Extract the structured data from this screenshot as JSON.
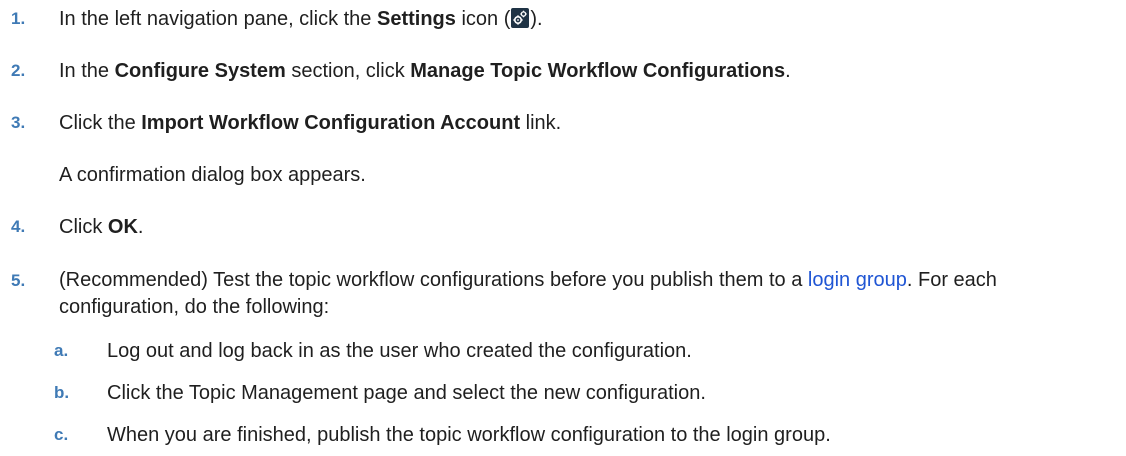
{
  "steps": [
    {
      "number": "1.",
      "pre": "In the left navigation pane, click the ",
      "bold": "Settings",
      "mid": " icon (",
      "icon": "settings-gear-icon",
      "post": ")."
    },
    {
      "number": "2.",
      "pre": "In the ",
      "bold1": "Configure System",
      "mid": " section, click ",
      "bold2": "Manage Topic Workflow Configurations",
      "post": "."
    },
    {
      "number": "3.",
      "pre": "Click the ",
      "bold": "Import Workflow Configuration Account",
      "post": " link.",
      "note": "A confirmation dialog box appears."
    },
    {
      "number": "4.",
      "pre": "Click ",
      "bold": "OK",
      "post": "."
    },
    {
      "number": "5.",
      "pre": "(Recommended) Test the topic workflow configurations before you publish them to a ",
      "link": "login group",
      "post": ". For each configuration, do the following:",
      "substeps": [
        {
          "letter": "a.",
          "text": "Log out and log back in as the user who created the configuration."
        },
        {
          "letter": "b.",
          "text": "Click the Topic Management page and select the new configuration."
        },
        {
          "letter": "c.",
          "text": "When you are finished, publish the topic workflow configuration to the login group."
        }
      ]
    }
  ],
  "colors": {
    "number": "#3f7ab5",
    "link": "#1f55d4",
    "text": "#1f1f1f",
    "icon_bg": "#1f3345"
  }
}
